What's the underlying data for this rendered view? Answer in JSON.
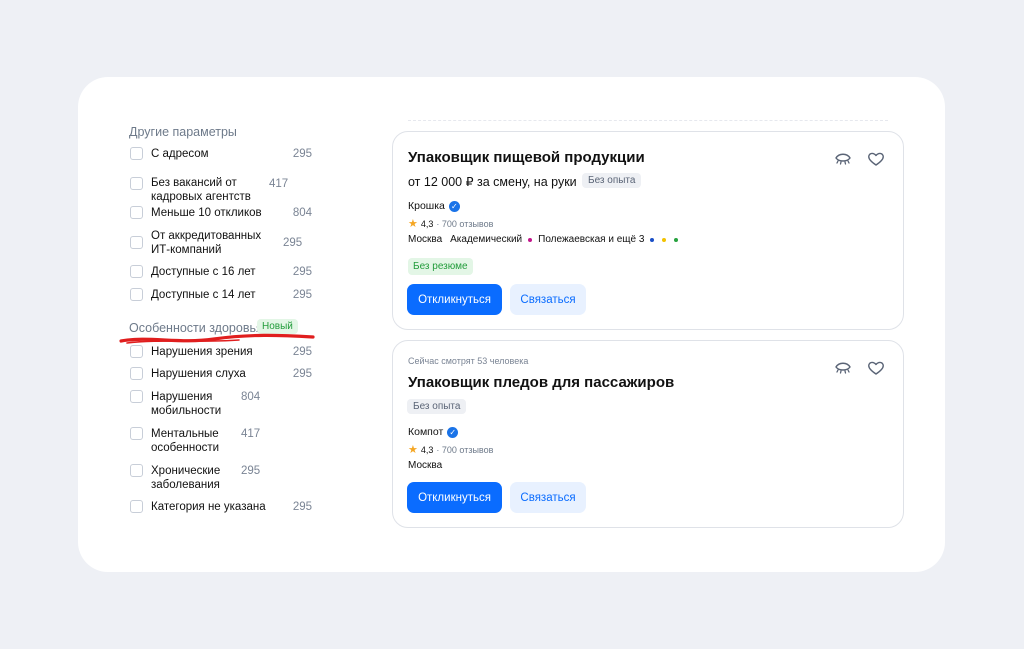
{
  "filters": {
    "other_title": "Другие параметры",
    "other_items": [
      {
        "label": "С адресом",
        "count": "295"
      },
      {
        "label": "Без вакансий от кадровых агентств",
        "count": "417"
      },
      {
        "label": "Меньше 10 откликов",
        "count": "804"
      },
      {
        "label": "От аккредитованных ИТ-компаний",
        "count": "295"
      },
      {
        "label": "Доступные с 16 лет",
        "count": "295"
      },
      {
        "label": "Доступные с 14 лет",
        "count": "295"
      }
    ],
    "health_title": "Особенности здоровья",
    "health_badge": "Новый",
    "health_items": [
      {
        "label": "Нарушения зрения",
        "count": "295"
      },
      {
        "label": "Нарушения слуха",
        "count": "295"
      },
      {
        "label": "Нарушения мобильности",
        "count": "804"
      },
      {
        "label": "Ментальные особенности",
        "count": "417"
      },
      {
        "label": "Хронические заболевания",
        "count": "295"
      },
      {
        "label": "Категория не указана",
        "count": "295"
      }
    ],
    "underline_color": "#e01e1e"
  },
  "vacancies": [
    {
      "title": "Упаковщик пищевой продукции",
      "salary": "от 12 000 ₽ за смену, на руки",
      "experience": "Без опыта",
      "company": "Крошка",
      "rating": "4,3",
      "reviews": "· 700 отзывов",
      "city": "Москва",
      "metro_1": "Академический",
      "metro_2": "Полежаевская и ещё 3",
      "no_resume": "Без резюме",
      "apply": "Откликнуться",
      "contact": "Связаться"
    },
    {
      "watching": "Сейчас смотрят 53 человека",
      "title": "Упаковщик пледов для пассажиров",
      "experience": "Без опыта",
      "company": "Компот",
      "rating": "4,3",
      "reviews": "· 700 отзывов",
      "city": "Москва",
      "apply": "Откликнуться",
      "contact": "Связаться"
    }
  ],
  "icons": [
    "hide-eye-icon",
    "heart-icon",
    "verified-icon",
    "star-icon"
  ],
  "colors": {
    "primary": "#0a6cff",
    "secondary_bg": "#e8f1ff",
    "green": "#229c3b",
    "metro_magenta": "#c2168b",
    "metro_blue": "#1a4fc7",
    "metro_yellow": "#f2c200",
    "metro_green": "#27a23f"
  }
}
